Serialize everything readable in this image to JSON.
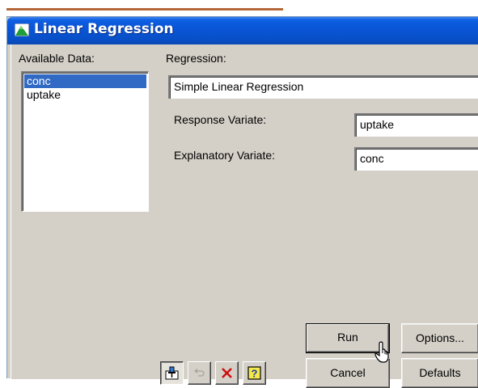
{
  "window": {
    "title": "Linear Regression",
    "app_icon": "mountain-app-icon"
  },
  "available_data": {
    "label": "Available Data:",
    "items": [
      {
        "label": "conc",
        "selected": true
      },
      {
        "label": "uptake",
        "selected": false
      }
    ]
  },
  "regression": {
    "label": "Regression:",
    "value": "Simple Linear Regression"
  },
  "response_variate": {
    "label": "Response Variate:",
    "value": "uptake"
  },
  "explanatory_variate": {
    "label": "Explanatory Variate:",
    "value": "conc"
  },
  "buttons": {
    "run": "Run",
    "options": "Options...",
    "cancel": "Cancel",
    "defaults": "Defaults"
  },
  "toolbar": [
    {
      "icon": "pin-icon"
    },
    {
      "icon": "undo-icon"
    },
    {
      "icon": "clear-icon"
    },
    {
      "icon": "help-icon"
    }
  ],
  "colors": {
    "titlebar": "#0a55d6",
    "selection": "#316ac5",
    "dialog_face": "#d4d0c8",
    "accent_line": "#b5673a"
  }
}
